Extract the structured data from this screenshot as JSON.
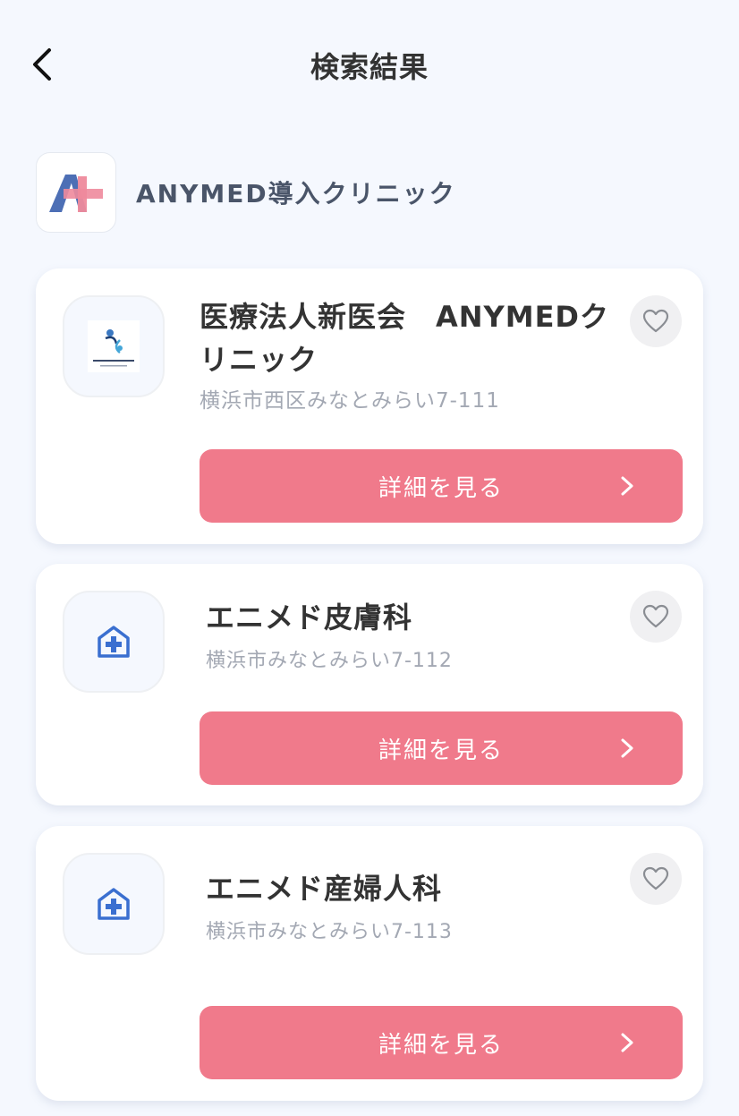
{
  "header": {
    "title": "検索結果",
    "back_icon": "chevron-left-icon"
  },
  "brand": {
    "name": "ANYMED導入クリニック",
    "logo_icon": "anymed-logo"
  },
  "colors": {
    "background": "#f5f8fe",
    "accent": "#f07a8b",
    "icon_blue": "#3a6fd0"
  },
  "clinics": [
    {
      "name_line1": "医療法人新医会　ANYMEDク",
      "name_line2": "リニック",
      "address": "横浜市西区みなとみらい7-111",
      "button_label": "詳細を見る",
      "icon": "clinic-logo-image",
      "favorite_icon": "heart-icon"
    },
    {
      "name_line1": "エニメド皮膚科",
      "address": "横浜市みなとみらい7-112",
      "button_label": "詳細を見る",
      "icon": "hospital-icon",
      "favorite_icon": "heart-icon"
    },
    {
      "name_line1": "エニメド産婦人科",
      "address": "横浜市みなとみらい7-113",
      "button_label": "詳細を見る",
      "icon": "hospital-icon",
      "favorite_icon": "heart-icon"
    }
  ]
}
